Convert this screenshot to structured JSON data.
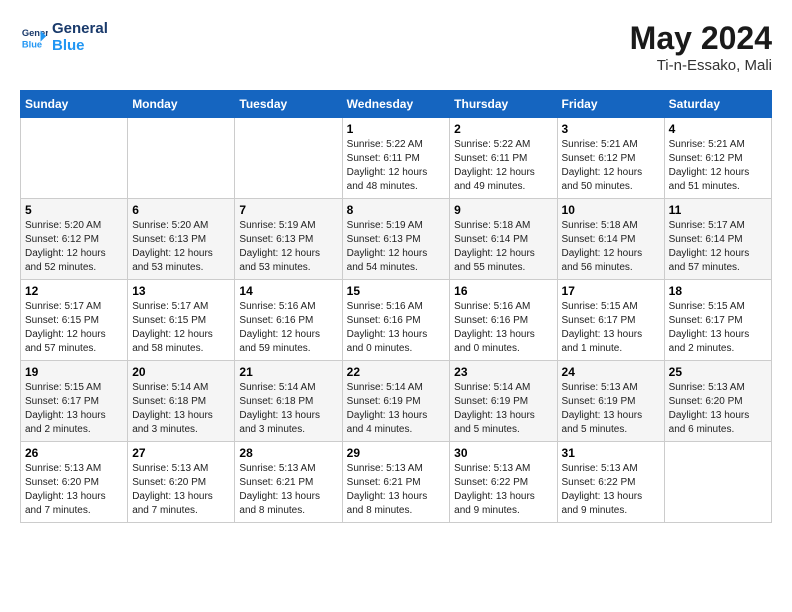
{
  "logo": {
    "line1": "General",
    "line2": "Blue"
  },
  "title": "May 2024",
  "subtitle": "Ti-n-Essako, Mali",
  "days_of_week": [
    "Sunday",
    "Monday",
    "Tuesday",
    "Wednesday",
    "Thursday",
    "Friday",
    "Saturday"
  ],
  "weeks": [
    [
      {
        "day": "",
        "info": ""
      },
      {
        "day": "",
        "info": ""
      },
      {
        "day": "",
        "info": ""
      },
      {
        "day": "1",
        "info": "Sunrise: 5:22 AM\nSunset: 6:11 PM\nDaylight: 12 hours\nand 48 minutes."
      },
      {
        "day": "2",
        "info": "Sunrise: 5:22 AM\nSunset: 6:11 PM\nDaylight: 12 hours\nand 49 minutes."
      },
      {
        "day": "3",
        "info": "Sunrise: 5:21 AM\nSunset: 6:12 PM\nDaylight: 12 hours\nand 50 minutes."
      },
      {
        "day": "4",
        "info": "Sunrise: 5:21 AM\nSunset: 6:12 PM\nDaylight: 12 hours\nand 51 minutes."
      }
    ],
    [
      {
        "day": "5",
        "info": "Sunrise: 5:20 AM\nSunset: 6:12 PM\nDaylight: 12 hours\nand 52 minutes."
      },
      {
        "day": "6",
        "info": "Sunrise: 5:20 AM\nSunset: 6:13 PM\nDaylight: 12 hours\nand 53 minutes."
      },
      {
        "day": "7",
        "info": "Sunrise: 5:19 AM\nSunset: 6:13 PM\nDaylight: 12 hours\nand 53 minutes."
      },
      {
        "day": "8",
        "info": "Sunrise: 5:19 AM\nSunset: 6:13 PM\nDaylight: 12 hours\nand 54 minutes."
      },
      {
        "day": "9",
        "info": "Sunrise: 5:18 AM\nSunset: 6:14 PM\nDaylight: 12 hours\nand 55 minutes."
      },
      {
        "day": "10",
        "info": "Sunrise: 5:18 AM\nSunset: 6:14 PM\nDaylight: 12 hours\nand 56 minutes."
      },
      {
        "day": "11",
        "info": "Sunrise: 5:17 AM\nSunset: 6:14 PM\nDaylight: 12 hours\nand 57 minutes."
      }
    ],
    [
      {
        "day": "12",
        "info": "Sunrise: 5:17 AM\nSunset: 6:15 PM\nDaylight: 12 hours\nand 57 minutes."
      },
      {
        "day": "13",
        "info": "Sunrise: 5:17 AM\nSunset: 6:15 PM\nDaylight: 12 hours\nand 58 minutes."
      },
      {
        "day": "14",
        "info": "Sunrise: 5:16 AM\nSunset: 6:16 PM\nDaylight: 12 hours\nand 59 minutes."
      },
      {
        "day": "15",
        "info": "Sunrise: 5:16 AM\nSunset: 6:16 PM\nDaylight: 13 hours\nand 0 minutes."
      },
      {
        "day": "16",
        "info": "Sunrise: 5:16 AM\nSunset: 6:16 PM\nDaylight: 13 hours\nand 0 minutes."
      },
      {
        "day": "17",
        "info": "Sunrise: 5:15 AM\nSunset: 6:17 PM\nDaylight: 13 hours\nand 1 minute."
      },
      {
        "day": "18",
        "info": "Sunrise: 5:15 AM\nSunset: 6:17 PM\nDaylight: 13 hours\nand 2 minutes."
      }
    ],
    [
      {
        "day": "19",
        "info": "Sunrise: 5:15 AM\nSunset: 6:17 PM\nDaylight: 13 hours\nand 2 minutes."
      },
      {
        "day": "20",
        "info": "Sunrise: 5:14 AM\nSunset: 6:18 PM\nDaylight: 13 hours\nand 3 minutes."
      },
      {
        "day": "21",
        "info": "Sunrise: 5:14 AM\nSunset: 6:18 PM\nDaylight: 13 hours\nand 3 minutes."
      },
      {
        "day": "22",
        "info": "Sunrise: 5:14 AM\nSunset: 6:19 PM\nDaylight: 13 hours\nand 4 minutes."
      },
      {
        "day": "23",
        "info": "Sunrise: 5:14 AM\nSunset: 6:19 PM\nDaylight: 13 hours\nand 5 minutes."
      },
      {
        "day": "24",
        "info": "Sunrise: 5:13 AM\nSunset: 6:19 PM\nDaylight: 13 hours\nand 5 minutes."
      },
      {
        "day": "25",
        "info": "Sunrise: 5:13 AM\nSunset: 6:20 PM\nDaylight: 13 hours\nand 6 minutes."
      }
    ],
    [
      {
        "day": "26",
        "info": "Sunrise: 5:13 AM\nSunset: 6:20 PM\nDaylight: 13 hours\nand 7 minutes."
      },
      {
        "day": "27",
        "info": "Sunrise: 5:13 AM\nSunset: 6:20 PM\nDaylight: 13 hours\nand 7 minutes."
      },
      {
        "day": "28",
        "info": "Sunrise: 5:13 AM\nSunset: 6:21 PM\nDaylight: 13 hours\nand 8 minutes."
      },
      {
        "day": "29",
        "info": "Sunrise: 5:13 AM\nSunset: 6:21 PM\nDaylight: 13 hours\nand 8 minutes."
      },
      {
        "day": "30",
        "info": "Sunrise: 5:13 AM\nSunset: 6:22 PM\nDaylight: 13 hours\nand 9 minutes."
      },
      {
        "day": "31",
        "info": "Sunrise: 5:13 AM\nSunset: 6:22 PM\nDaylight: 13 hours\nand 9 minutes."
      },
      {
        "day": "",
        "info": ""
      }
    ]
  ]
}
